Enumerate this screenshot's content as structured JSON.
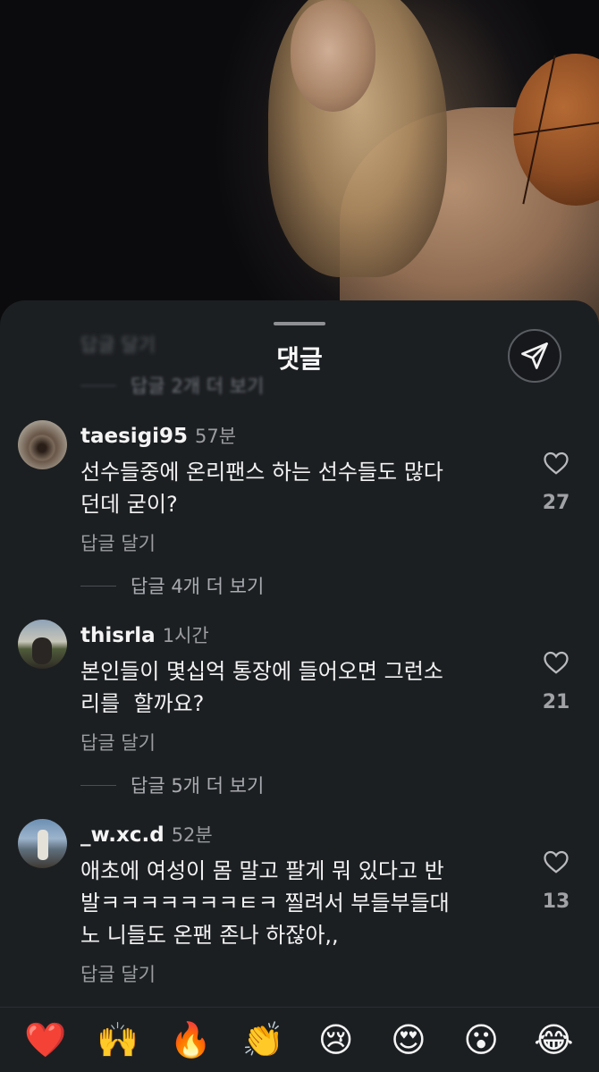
{
  "sheet": {
    "title": "댓글",
    "share_icon": "send-icon"
  },
  "ghost": {
    "reply_label": "답글 달기",
    "more_label": "답글 2개 더 보기"
  },
  "comments": [
    {
      "username": "taesigi95",
      "time": "57분",
      "text": "선수들중에 온리팬스 하는 선수들도 많다\n던데 굳이?",
      "reply_label": "답글 달기",
      "more_replies": "답글 4개 더 보기",
      "likes": "27"
    },
    {
      "username": "thisrla",
      "time": "1시간",
      "text": "본인들이 몇십억 통장에 들어오면 그런소\n리를  할까요?",
      "reply_label": "답글 달기",
      "more_replies": "답글 5개 더 보기",
      "likes": "21"
    },
    {
      "username": "_w.xc.d",
      "time": "52분",
      "text": "애초에 여성이 몸 말고 팔게 뭐 있다고 반\n발ㅋㅋㅋㅋㅋㅋㅋㅌㅋ 찔려서 부들부들대\n노 니들도 온팬 존나 하잖아,,",
      "reply_label": "답글 달기",
      "likes": "13"
    }
  ],
  "emoji_bar": [
    "❤️",
    "🙌",
    "🔥",
    "👏",
    "😢",
    "😍",
    "😮",
    "😂"
  ]
}
